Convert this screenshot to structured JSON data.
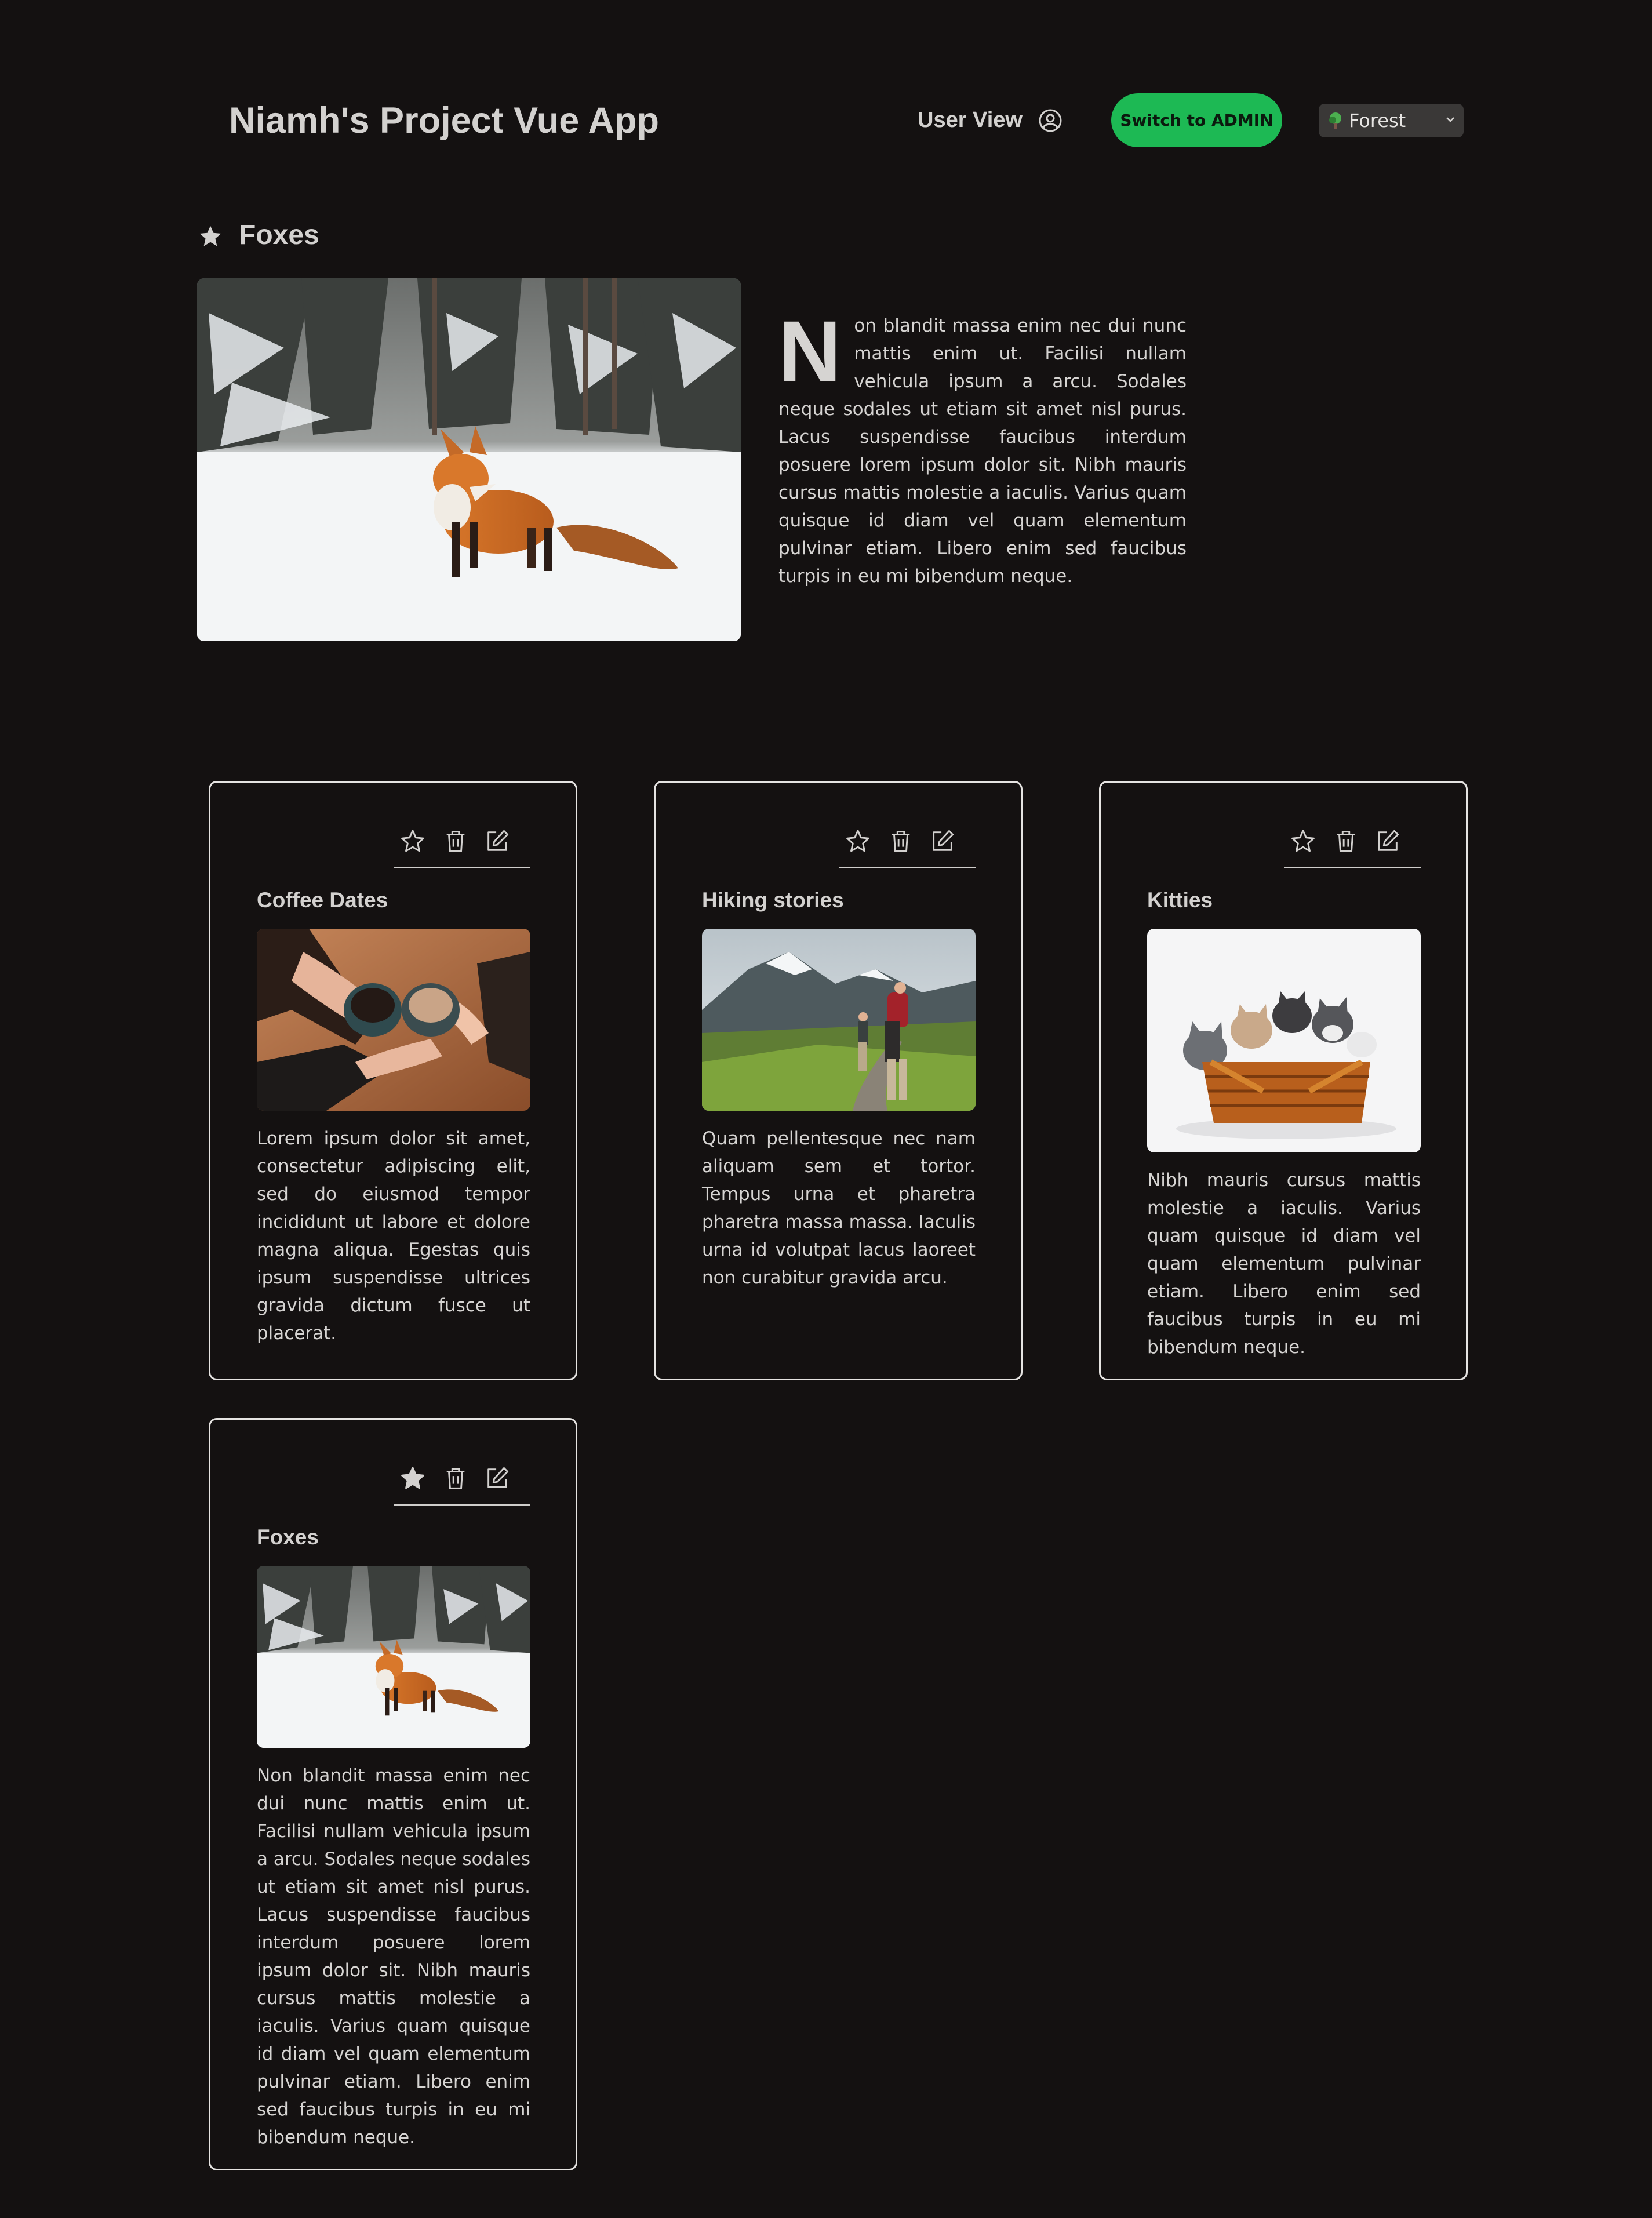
{
  "header": {
    "app_title": "Niamh's Project Vue App",
    "user_view_label": "User View",
    "user_icon": "user-circle-icon",
    "switch_button_label": "Switch to ADMIN",
    "theme_select": {
      "selected": "Forest",
      "icon": "tree-icon"
    }
  },
  "favorite": {
    "icon": "star-filled-icon",
    "title": "Foxes",
    "dropcap": "N",
    "text": "on blandit massa enim nec dui nunc mattis enim ut. Facilisi nullam vehicula ipsum a arcu. Sodales neque sodales ut etiam sit amet nisl purus. Lacus suspendisse faucibus interdum posuere lorem ipsum dolor sit. Nibh mauris cursus mattis molestie a iaculis. Varius quam quisque id diam vel quam elementum pulvinar etiam. Libero enim sed faucibus turpis in eu mi bibendum neque."
  },
  "cards": [
    {
      "title": "Coffee Dates",
      "favorited": false,
      "text": "Lorem ipsum dolor sit amet, consectetur adipiscing elit, sed do eiusmod tempor incididunt ut labore et dolore magna aliqua. Egestas quis ipsum suspendisse ultrices gravida dictum fusce ut placerat."
    },
    {
      "title": "Hiking stories",
      "favorited": false,
      "text": "Quam pellentesque nec nam aliquam sem et tortor. Tempus urna et pharetra pharetra massa massa. Iaculis urna id volutpat lacus laoreet non curabitur gravida arcu."
    },
    {
      "title": "Kitties",
      "favorited": false,
      "text": "Nibh mauris cursus mattis molestie a iaculis. Varius quam quisque id diam vel quam elementum pulvinar etiam. Libero enim sed faucibus turpis in eu mi bibendum neque."
    },
    {
      "title": "Foxes",
      "favorited": true,
      "text": "Non blandit massa enim nec dui nunc mattis enim ut. Facilisi nullam vehicula ipsum a arcu. Sodales neque sodales ut etiam sit amet nisl purus. Lacus suspendisse faucibus interdum posuere lorem ipsum dolor sit. Nibh mauris cursus mattis molestie a iaculis. Varius quam quisque id diam vel quam elementum pulvinar etiam. Libero enim sed faucibus turpis in eu mi bibendum neque."
    }
  ],
  "card_icons": {
    "favorite": "star-icon",
    "delete": "trash-icon",
    "edit": "edit-pencil-icon"
  },
  "colors": {
    "background": "#141111",
    "accent": "#1db954",
    "text": "#d3d1cf"
  }
}
